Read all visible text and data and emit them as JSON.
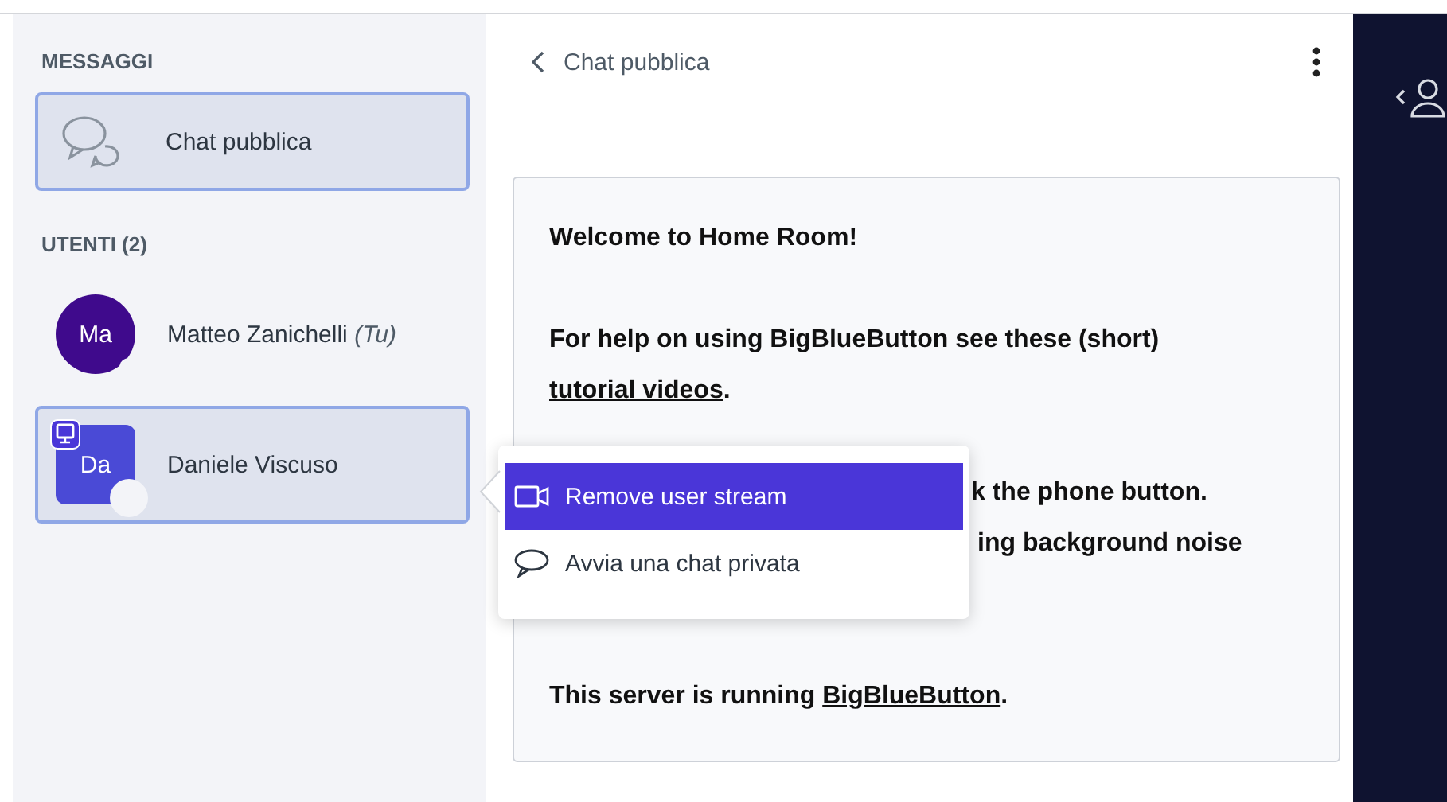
{
  "sidebar": {
    "messages_heading": "MESSAGGI",
    "chats": [
      {
        "label": "Chat pubblica",
        "selected": true
      }
    ],
    "users_heading": "UTENTI (2)",
    "users": [
      {
        "initials": "Ma",
        "name": "Matteo Zanichelli",
        "you_tag": "(Tu)",
        "kind": "circle",
        "color": "#3f0a8c",
        "presenter": false,
        "selected": false
      },
      {
        "initials": "Da",
        "name": "Daniele Viscuso",
        "kind": "square",
        "color": "#4a4ad6",
        "presenter": true,
        "selected": true
      }
    ]
  },
  "chat": {
    "title": "Chat pubblica",
    "message": [
      [
        {
          "kind": "plain",
          "text": "Welcome to "
        },
        {
          "kind": "strong",
          "text": "Home Room"
        },
        {
          "kind": "plain",
          "text": "!"
        }
      ],
      [
        {
          "kind": "plain",
          "text": "For help on using BigBlueButton see these (short) "
        },
        {
          "kind": "link",
          "text": "tutorial videos"
        },
        {
          "kind": "plain",
          "text": "."
        }
      ],
      [
        {
          "kind": "partial",
          "text": "k the phone button."
        },
        {
          "kind": "partial",
          "text": "ing background noise"
        }
      ],
      [
        {
          "kind": "plain",
          "text": "This server is running "
        },
        {
          "kind": "link",
          "text": "BigBlueButton"
        },
        {
          "kind": "plain",
          "text": "."
        }
      ]
    ]
  },
  "context_menu": {
    "items": [
      {
        "label": "Remove user stream",
        "selected": true
      },
      {
        "label": "Avvia una chat privata",
        "selected": false
      }
    ]
  }
}
